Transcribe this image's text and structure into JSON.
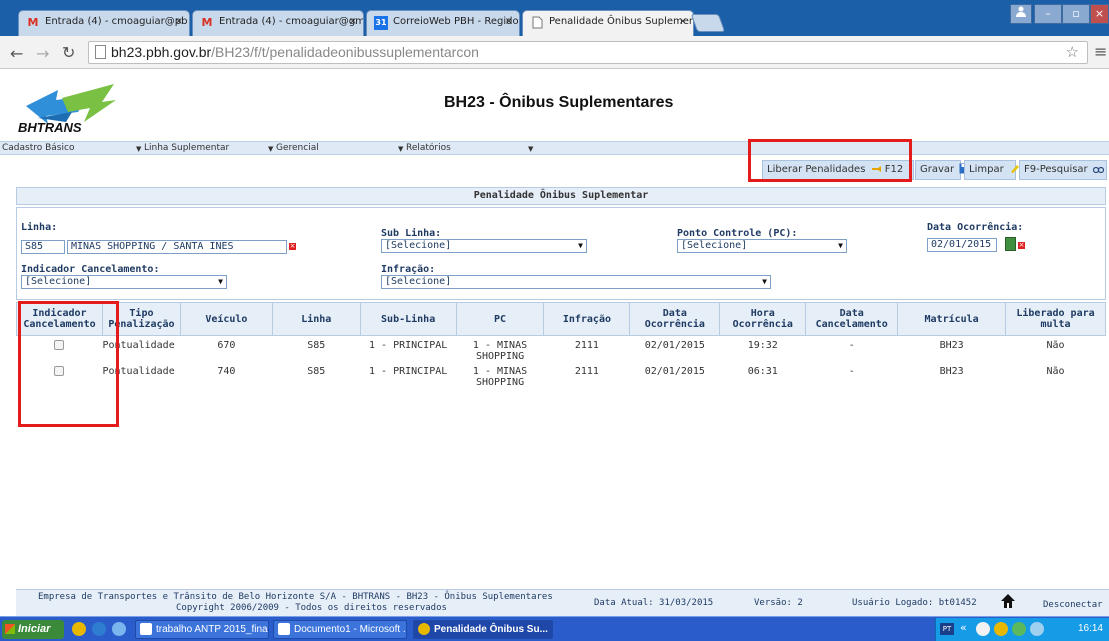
{
  "browser": {
    "tabs": [
      {
        "title": "Entrada (4) - cmoaguiar@pb",
        "icon": "gmail-icon"
      },
      {
        "title": "Entrada (4) - cmoaguiar@gm",
        "icon": "gmail-icon"
      },
      {
        "title": "CorreioWeb PBH - Regido pe",
        "icon": "calendar-icon",
        "badge": "31"
      },
      {
        "title": "Penalidade Ônibus Suplemen",
        "icon": "document-icon"
      }
    ],
    "url_host": "bh23.pbh.gov.br",
    "url_path": "/BH23/f/t/penalidadeonibussuplementarcon",
    "close_glyph": "×"
  },
  "header": {
    "logo_text": "BHTRANS",
    "title": "BH23 - Ônibus Suplementares"
  },
  "menu": [
    "Cadastro Básico",
    "Linha Suplementar",
    "Gerencial",
    "Relatórios"
  ],
  "toolbar": {
    "release": "Liberar Penalidades",
    "save_key": "F12",
    "save": "Gravar",
    "clear": "Limpar",
    "search": "F9-Pesquisar"
  },
  "section_title": "Penalidade Ônibus Suplementar",
  "form": {
    "linha_label": "Linha:",
    "linha_code": "S85",
    "linha_name": "MINAS SHOPPING / SANTA INES",
    "sublinha_label": "Sub Linha:",
    "sublinha_value": "[Selecione]",
    "pc_label": "Ponto Controle (PC):",
    "pc_value": "[Selecione]",
    "data_label": "Data Ocorrência:",
    "data_value": "02/01/2015",
    "indicador_label": "Indicador Cancelamento:",
    "indicador_value": "[Selecione]",
    "infracao_label": "Infração:",
    "infracao_value": "[Selecione]"
  },
  "table": {
    "headers": [
      [
        "Indicador",
        "Cancelamento"
      ],
      [
        "Tipo",
        "Penalização"
      ],
      [
        "Veículo",
        ""
      ],
      [
        "Linha",
        ""
      ],
      [
        "Sub-Linha",
        ""
      ],
      [
        "PC",
        ""
      ],
      [
        "Infração",
        ""
      ],
      [
        "Data",
        "Ocorrência"
      ],
      [
        "Hora",
        "Ocorrência"
      ],
      [
        "Data",
        "Cancelamento"
      ],
      [
        "Matrícula",
        ""
      ],
      [
        "Liberado para",
        "multa"
      ]
    ],
    "rows": [
      {
        "tipo": "Pontualidade",
        "veiculo": "670",
        "linha": "S85",
        "sublinha": "1 - PRINCIPAL",
        "pc1": "1 - MINAS",
        "pc2": "SHOPPING",
        "infracao": "2111",
        "data": "02/01/2015",
        "hora": "19:32",
        "cancel": "-",
        "matricula": "BH23",
        "liberado": "Não"
      },
      {
        "tipo": "Pontualidade",
        "veiculo": "740",
        "linha": "S85",
        "sublinha": "1 - PRINCIPAL",
        "pc1": "1 - MINAS",
        "pc2": "SHOPPING",
        "infracao": "2111",
        "data": "02/01/2015",
        "hora": "06:31",
        "cancel": "-",
        "matricula": "BH23",
        "liberado": "Não"
      }
    ]
  },
  "footer": {
    "company": "Empresa de Transportes e Trânsito de Belo Horizonte S/A - BHTRANS - BH23 - Ônibus Suplementares",
    "copyright": "Copyright 2006/2009 - Todos os direitos reservados",
    "date": "Data Atual: 31/03/2015",
    "version": "Versão: 2",
    "user": "Usuário Logado: bt01452",
    "logout": "Desconectar"
  },
  "taskbar": {
    "start": "Iniciar",
    "tasks": [
      "trabalho ANTP 2015_fina...",
      "Documento1 - Microsoft ...",
      "Penalidade Ônibus Su..."
    ],
    "clock": "16:14",
    "tray_label": "PT"
  }
}
